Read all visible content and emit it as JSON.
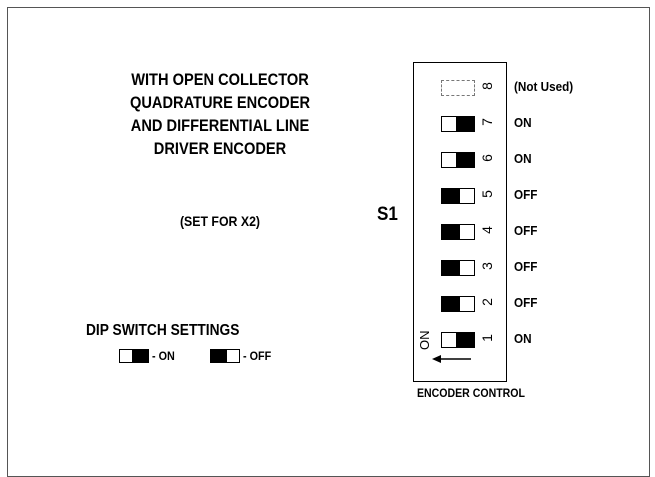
{
  "heading_lines": [
    "WITH OPEN COLLECTOR",
    "QUADRATURE ENCODER",
    "AND DIFFERENTIAL LINE",
    "DRIVER ENCODER"
  ],
  "set_for": "(SET FOR X2)",
  "switch_label": "S1",
  "dip_title": "DIP SWITCH SETTINGS",
  "legend": {
    "on_text": "- ON",
    "off_text": "- OFF"
  },
  "switches": [
    {
      "number": "8",
      "state": "(Not Used)",
      "mode": "unused"
    },
    {
      "number": "7",
      "state": "ON",
      "mode": "on"
    },
    {
      "number": "6",
      "state": "ON",
      "mode": "on"
    },
    {
      "number": "5",
      "state": "OFF",
      "mode": "off"
    },
    {
      "number": "4",
      "state": "OFF",
      "mode": "off"
    },
    {
      "number": "3",
      "state": "OFF",
      "mode": "off"
    },
    {
      "number": "2",
      "state": "OFF",
      "mode": "off"
    },
    {
      "number": "1",
      "state": "ON",
      "mode": "on"
    }
  ],
  "on_marker": "ON",
  "footer_label": "ENCODER CONTROL"
}
